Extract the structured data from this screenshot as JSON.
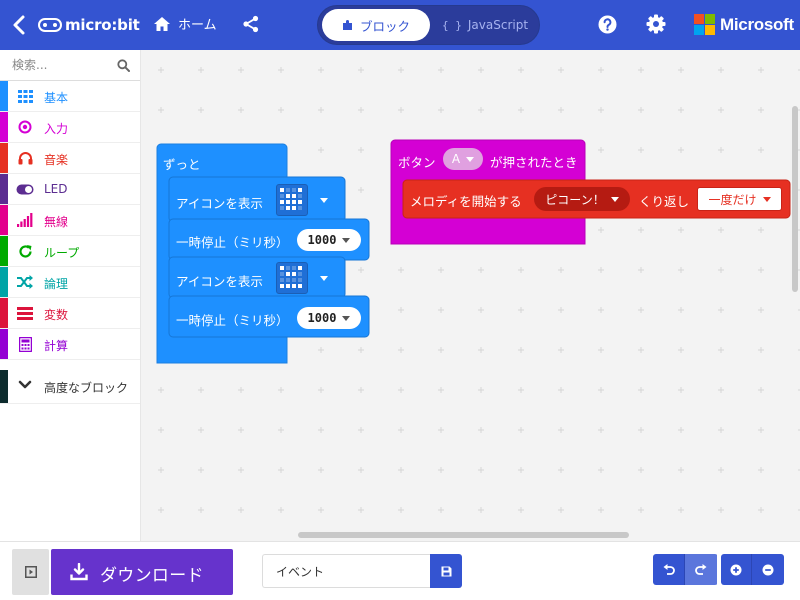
{
  "app": {
    "logo_text": "micro:bit",
    "home_label": "ホーム",
    "brand": "Microsoft"
  },
  "modes": {
    "blocks": "ブロック",
    "javascript": "JavaScript"
  },
  "toolbox": {
    "search_placeholder": "検索...",
    "categories": [
      {
        "label": "基本",
        "color": "#1e90ff",
        "icon": "grid-icon"
      },
      {
        "label": "入力",
        "color": "#d400d4",
        "icon": "target-icon"
      },
      {
        "label": "音楽",
        "color": "#e63022",
        "icon": "headphones-icon"
      },
      {
        "label": "LED",
        "color": "#5c2d91",
        "icon": "toggle-icon"
      },
      {
        "label": "無線",
        "color": "#e3008c",
        "icon": "signal-bars-icon"
      },
      {
        "label": "ループ",
        "color": "#00aa00",
        "icon": "refresh-icon"
      },
      {
        "label": "論理",
        "color": "#00a4a6",
        "icon": "shuffle-icon"
      },
      {
        "label": "変数",
        "color": "#dc143c",
        "icon": "stack-icon"
      },
      {
        "label": "計算",
        "color": "#9400d3",
        "icon": "calculator-icon"
      }
    ],
    "advanced_label": "高度なブロック"
  },
  "workspace": {
    "forever": {
      "label": "ずっと",
      "color": "#1e90ff",
      "statements": [
        {
          "label": "アイコンを表示",
          "type": "icon"
        },
        {
          "label": "一時停止（ミリ秒）",
          "value": "1000"
        },
        {
          "label": "アイコンを表示",
          "type": "icon"
        },
        {
          "label": "一時停止（ミリ秒）",
          "value": "1000"
        }
      ]
    },
    "on_button": {
      "prefix": "ボタン",
      "button": "A",
      "suffix": "が押されたとき",
      "color": "#d400d4",
      "statement": {
        "label": "メロディを開始する",
        "melody": "ピコーン！",
        "repeat_label": "くり返し",
        "repeat_value": "一度だけ",
        "color": "#e63022"
      }
    }
  },
  "bottom": {
    "download_label": "ダウンロード",
    "project_name": "イベント"
  }
}
